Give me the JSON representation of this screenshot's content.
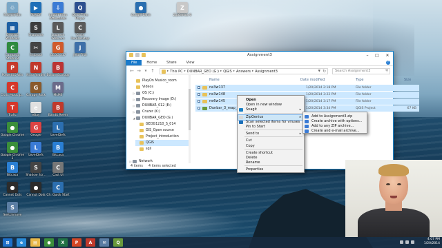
{
  "desktop": {
    "icons": [
      {
        "label": "Recycle Bin",
        "color": "#7aa7c7",
        "glyph": "♲"
      },
      {
        "label": "PlayOn",
        "color": "#1e6fb8",
        "glyph": "▶"
      },
      {
        "label": "Import from Attestation",
        "color": "#3a7bd5",
        "glyph": "⇩"
      },
      {
        "label": "QuickTime Player",
        "color": "#2c4f8f",
        "glyph": "Q"
      },
      {
        "label": "Google Earth",
        "color": "#2b6fb0",
        "glyph": "●"
      },
      {
        "label": "ZipGenius 6",
        "color": "#c8c8c8",
        "glyph": "Z"
      },
      {
        "label": "Desktop Windows",
        "color": "#1d5fa3",
        "glyph": "▦"
      },
      {
        "label": "Snapfolds",
        "color": "#3d3d3d",
        "glyph": "S"
      },
      {
        "label": "Logitech Webcam",
        "color": "#5a5a5a",
        "glyph": "L"
      },
      {
        "label": "Citrix XenDesktop",
        "color": "#5a5a5a",
        "glyph": "C"
      },
      {
        "label": "Camtasia Studio 8",
        "color": "#2f8a3f",
        "glyph": "C"
      },
      {
        "label": "Sniptool",
        "color": "#444",
        "glyph": "✂"
      },
      {
        "label": "GEOG 317",
        "color": "#d05a2c",
        "glyph": "G"
      },
      {
        "label": "Jeko Trial",
        "color": "#3d6fa8",
        "glyph": "J"
      },
      {
        "label": "PowerISO Win",
        "color": "#c43b2e",
        "glyph": "P"
      },
      {
        "label": "Nitro Reader",
        "color": "#c0392b",
        "glyph": "N"
      },
      {
        "label": "Bollow Ecology",
        "color": "#b33",
        "glyph": "B"
      },
      {
        "label": "Citrix Music p...",
        "color": "#d4372c",
        "glyph": "C"
      },
      {
        "label": "Garage Rock",
        "color": "#8a5a2c",
        "glyph": "G"
      },
      {
        "label": "MkMS",
        "color": "#6b6b8a",
        "glyph": "M"
      },
      {
        "label": "Trafic",
        "color": "#d4372c",
        "glyph": "T"
      },
      {
        "label": "eBay",
        "color": "#e0e0e0",
        "glyph": "e"
      },
      {
        "label": "Bandit Reem",
        "color": "#c0392b",
        "glyph": "B"
      },
      {
        "label": "Google Chrome",
        "color": "#3b8f3b",
        "glyph": "●"
      },
      {
        "label": "Geogle",
        "color": "#d44",
        "glyph": "G"
      },
      {
        "label": "LevelDefs",
        "color": "#2c6fb0",
        "glyph": "L"
      },
      {
        "label": "Google Chrome 2",
        "color": "#3b8f3b",
        "glyph": "●"
      },
      {
        "label": "LevelDefs",
        "color": "#3a7bd5",
        "glyph": "L"
      },
      {
        "label": "Bitcasa",
        "color": "#2a7fd4",
        "glyph": "B"
      },
      {
        "label": "Bitcasa",
        "color": "#2a7fd4",
        "glyph": "B"
      },
      {
        "label": "Shadow Scr...",
        "color": "#444",
        "glyph": "S"
      },
      {
        "label": "Cast Ui",
        "color": "#777",
        "glyph": "C"
      },
      {
        "label": "Cannot Dots",
        "color": "#2c2c2c",
        "glyph": "●"
      },
      {
        "label": "Cannot Dots",
        "color": "#2c2c2c",
        "glyph": "●"
      },
      {
        "label": "Ch. Quick Start",
        "color": "#2c6fb0",
        "glyph": "C"
      },
      {
        "label": "Switchmove",
        "color": "#5a7da3",
        "glyph": "S"
      }
    ]
  },
  "explorer": {
    "title": "Assignment3",
    "tabs": [
      "File",
      "Home",
      "Share",
      "View"
    ],
    "help": "?",
    "address": [
      "This PC",
      "DUNBAR_GEO (G:)",
      "QGIS",
      "Answers",
      "Assignment3"
    ],
    "search_placeholder": "Search Assignment3",
    "nav_items": [
      {
        "label": "PlayOn Musico_room",
        "icon": "folder",
        "indent": 2,
        "expand": ""
      },
      {
        "label": "Videos",
        "icon": "folder",
        "indent": 2,
        "expand": ""
      },
      {
        "label": "OS (C:)",
        "icon": "drive",
        "indent": 2,
        "expand": "▷"
      },
      {
        "label": "Recovery Image (D:)",
        "icon": "drive",
        "indent": 2,
        "expand": "▷"
      },
      {
        "label": "DUNBAR_012 (E:)",
        "icon": "drive",
        "indent": 2,
        "expand": "▷"
      },
      {
        "label": "Cruzer (K:)",
        "icon": "drive",
        "indent": 2,
        "expand": "▷"
      },
      {
        "label": "DUNBAR_GEO (G:)",
        "icon": "drive",
        "indent": 2,
        "expand": "◢"
      },
      {
        "label": "GEOG1210_S_014",
        "icon": "folder",
        "indent": 3,
        "expand": ""
      },
      {
        "label": "GIS_Open source",
        "icon": "folder",
        "indent": 3,
        "expand": ""
      },
      {
        "label": "Project_introduction",
        "icon": "folder",
        "indent": 3,
        "expand": ""
      },
      {
        "label": "QGIS",
        "icon": "folder",
        "indent": 3,
        "expand": "",
        "selected": true
      },
      {
        "label": "sqli",
        "icon": "folder",
        "indent": 3,
        "expand": ""
      },
      {
        "label": "",
        "icon": "",
        "indent": 0,
        "expand": ""
      },
      {
        "label": "Network",
        "icon": "drive",
        "indent": 1,
        "expand": "▷"
      }
    ],
    "columns": [
      "Name",
      "Date modified",
      "Type",
      "Size"
    ],
    "files": [
      {
        "name": "ne3w137",
        "date": "1/20/2014 2:18 PM",
        "type": "File folder",
        "size": "",
        "icon": "folder"
      },
      {
        "name": "ne3w148",
        "date": "1/20/2014 3:22 PM",
        "type": "File folder",
        "size": "",
        "icon": "folder"
      },
      {
        "name": "ne6w145",
        "date": "1/20/2014 3:17 PM",
        "type": "File folder",
        "size": "",
        "icon": "folder"
      },
      {
        "name": "Dunbar_3_map_fund...",
        "date": "1/20/2014 3:34 PM",
        "type": "QGIS Project",
        "size": "67 KB",
        "icon": "qgis"
      }
    ],
    "status": {
      "count": "4 items",
      "selected": "4 items selected"
    }
  },
  "context_menu": {
    "items": [
      {
        "label": "Open",
        "bold": true
      },
      {
        "label": "Open in new window"
      },
      {
        "label": "Snagit",
        "submenu": true,
        "icon": "#1a7fc4"
      },
      {
        "sep": true
      },
      {
        "label": "ZipGenius",
        "submenu": true,
        "highlight": true,
        "icon": "#d8d8d8"
      },
      {
        "label": "Scan selected items for viruses",
        "icon": "#1b6fb8"
      },
      {
        "label": "Pin to Start"
      },
      {
        "sep": true
      },
      {
        "label": "Send to",
        "submenu": true
      },
      {
        "sep": true
      },
      {
        "label": "Cut"
      },
      {
        "label": "Copy"
      },
      {
        "sep": true
      },
      {
        "label": "Create shortcut"
      },
      {
        "label": "Delete"
      },
      {
        "label": "Rename"
      },
      {
        "sep": true
      },
      {
        "label": "Properties"
      }
    ]
  },
  "submenu": {
    "items": [
      {
        "label": "Add to Assignment3.zip",
        "icon": "#3a7bd5"
      },
      {
        "label": "Create archive with options...",
        "icon": "#3a7bd5"
      },
      {
        "label": "Add to any ZIP archive...",
        "icon": "#3a7bd5"
      },
      {
        "label": "Create and e-mail archive...",
        "icon": "#3a7bd5"
      }
    ]
  },
  "taskbar": {
    "items": [
      {
        "name": "start-button",
        "glyph": "⊞",
        "color": "#1d6fc8"
      },
      {
        "name": "ie",
        "glyph": "e",
        "color": "#2a8bd8"
      },
      {
        "name": "explorer",
        "glyph": "▤",
        "color": "#e8b84a"
      },
      {
        "name": "chrome",
        "glyph": "●",
        "color": "#3b8f3b"
      },
      {
        "name": "excel",
        "glyph": "X",
        "color": "#217346"
      },
      {
        "name": "powerpoint",
        "glyph": "P",
        "color": "#d24726"
      },
      {
        "name": "acrobat",
        "glyph": "A",
        "color": "#c0392b"
      },
      {
        "name": "mail",
        "glyph": "✉",
        "color": "#5a7da3"
      },
      {
        "name": "qgis",
        "glyph": "Q",
        "color": "#6a9a3c"
      }
    ],
    "time": "4:07 PM",
    "date": "1/20/2014"
  },
  "colors": {
    "accent": "#1979ca",
    "selection": "#cce8ff"
  }
}
